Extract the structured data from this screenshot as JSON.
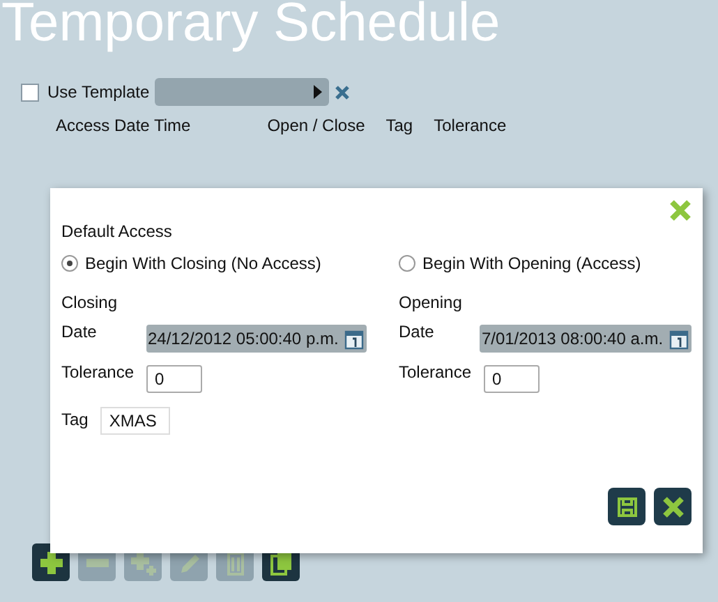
{
  "page": {
    "title": "Temporary Schedule"
  },
  "template": {
    "label": "Use Template",
    "checked": false
  },
  "table": {
    "columns": [
      "Access Date Time",
      "Open / Close",
      "Tag",
      "Tolerance"
    ]
  },
  "toolbar": [
    {
      "kind": "add",
      "disabled": false
    },
    {
      "kind": "remove",
      "disabled": true
    },
    {
      "kind": "add-multiple",
      "disabled": true
    },
    {
      "kind": "edit",
      "disabled": true
    },
    {
      "kind": "delete",
      "disabled": true
    },
    {
      "kind": "copy",
      "disabled": false
    }
  ],
  "dialog": {
    "heading": "Default Access",
    "options": [
      {
        "label": "Begin With Closing (No Access)",
        "selected": true
      },
      {
        "label": "Begin With Opening (Access)",
        "selected": false
      }
    ],
    "sections": [
      {
        "title": "Closing",
        "date_label": "Date",
        "date": "24/12/2012 05:00:40 p.m.",
        "tolerance_label": "Tolerance",
        "tolerance": "0"
      },
      {
        "title": "Opening",
        "date_label": "Date",
        "date": "7/01/2013 08:00:40 a.m.",
        "tolerance_label": "Tolerance",
        "tolerance": "0"
      }
    ],
    "tag_label": "Tag",
    "tag": "XMAS"
  }
}
